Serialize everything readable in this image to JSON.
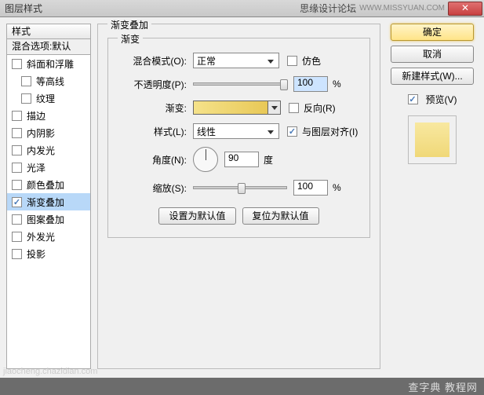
{
  "window": {
    "title": "图层样式",
    "brand": "思缘设计论坛",
    "url": "WWW.MISSYUAN.COM"
  },
  "left": {
    "header": "样式",
    "sub": "混合选项:默认",
    "items": [
      {
        "label": "斜面和浮雕",
        "checked": false,
        "indent": false
      },
      {
        "label": "等高线",
        "checked": false,
        "indent": true
      },
      {
        "label": "纹理",
        "checked": false,
        "indent": true
      },
      {
        "label": "描边",
        "checked": false,
        "indent": false
      },
      {
        "label": "内阴影",
        "checked": false,
        "indent": false
      },
      {
        "label": "内发光",
        "checked": false,
        "indent": false
      },
      {
        "label": "光泽",
        "checked": false,
        "indent": false
      },
      {
        "label": "颜色叠加",
        "checked": false,
        "indent": false
      },
      {
        "label": "渐变叠加",
        "checked": true,
        "indent": false,
        "selected": true
      },
      {
        "label": "图案叠加",
        "checked": false,
        "indent": false
      },
      {
        "label": "外发光",
        "checked": false,
        "indent": false
      },
      {
        "label": "投影",
        "checked": false,
        "indent": false
      }
    ]
  },
  "main": {
    "group_title": "渐变叠加",
    "inner_title": "渐变",
    "blend_mode_label": "混合模式(O):",
    "blend_mode_value": "正常",
    "dither_label": "仿色",
    "opacity_label": "不透明度(P):",
    "opacity_value": "100",
    "opacity_unit": "%",
    "gradient_label": "渐变:",
    "reverse_label": "反向(R)",
    "style_label": "样式(L):",
    "style_value": "线性",
    "align_label": "与图层对齐(I)",
    "align_checked": true,
    "angle_label": "角度(N):",
    "angle_value": "90",
    "angle_unit": "度",
    "scale_label": "缩放(S):",
    "scale_value": "100",
    "scale_unit": "%",
    "reset_default": "设置为默认值",
    "restore_default": "复位为默认值"
  },
  "right": {
    "ok": "确定",
    "cancel": "取消",
    "new_style": "新建样式(W)...",
    "preview_label": "预览(V)",
    "preview_checked": true
  },
  "footer": {
    "site": "查字典 教程网",
    "watermark": "jiaocheng.chazidian.com"
  }
}
